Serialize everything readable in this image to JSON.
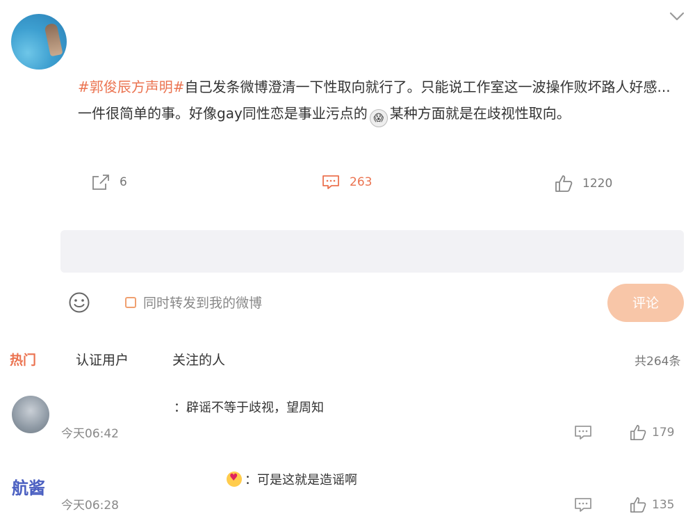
{
  "post": {
    "hashtag": "#郭俊辰方声明#",
    "text_a": "自己发条微博澄清一下性取向就行了。只能说工作室这一波操作败坏路人好感...一件很简单的事。好像gay同性恋是事业污点的",
    "text_b": "某种方面就是在歧视性取向。"
  },
  "actions": {
    "repost_count": "6",
    "comment_count": "263",
    "like_count": "1220"
  },
  "composer": {
    "checkbox_label": "同时转发到我的微博",
    "submit_label": "评论"
  },
  "tabs": {
    "hot": "热门",
    "verified": "认证用户",
    "following": "关注的人",
    "total": "共264条"
  },
  "comments": [
    {
      "text": "：辟谣不等于歧视，望周知",
      "time": "今天06:42",
      "likes": "179"
    },
    {
      "avatar_text": "航酱",
      "text": "：可是这就是造谣啊",
      "time": "今天06:28",
      "likes": "135"
    }
  ],
  "icons": [
    "chevron-down-icon",
    "repost-icon",
    "comment-icon",
    "like-icon",
    "smile-icon",
    "reply-icon"
  ],
  "colors": {
    "accent": "#eb7350",
    "submit_bg": "#f8c6a8",
    "box_bg": "#f2f2f5"
  }
}
